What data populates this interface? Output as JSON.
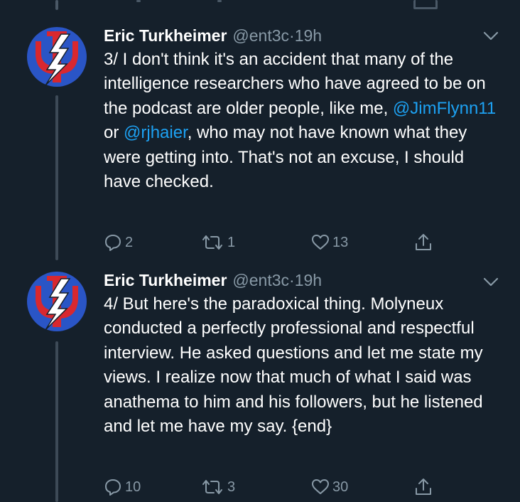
{
  "tweets": [
    {
      "author_name": "Eric Turkheimer",
      "handle": "@ent3c",
      "separator": "·",
      "time": "19h",
      "text_parts": [
        "3/ I don't think it's an accident that many of the intelligence researchers who have agreed to be on the podcast are older people, like me, ",
        "@JimFlynn11",
        " or ",
        "@rjhaier",
        ", who may not have known what they were getting into. That's not an excuse, I should have checked."
      ],
      "replies": "2",
      "retweets": "1",
      "likes": "13"
    },
    {
      "author_name": "Eric Turkheimer",
      "handle": "@ent3c",
      "separator": "·",
      "time": "19h",
      "text": "4/ But here's the paradoxical thing. Molyneux conducted a perfectly professional and respectful interview. He asked questions and let me state my views. I realize now that much of what I said was anathema to him and his followers, but he listened and let me have my say. {end}",
      "replies": "10",
      "retweets": "3",
      "likes": "30"
    }
  ],
  "icons": {
    "avatar": "grateful-dead-psi-lightning-icon",
    "reply": "reply-icon",
    "retweet": "retweet-icon",
    "like": "heart-icon",
    "share": "share-icon",
    "menu": "chevron-down-icon"
  },
  "colors": {
    "background": "#15202b",
    "text": "#ffffff",
    "muted": "#8899a6",
    "mention": "#1da1f2",
    "avatar_blue": "#2a55c6",
    "avatar_red": "#d8282f"
  }
}
